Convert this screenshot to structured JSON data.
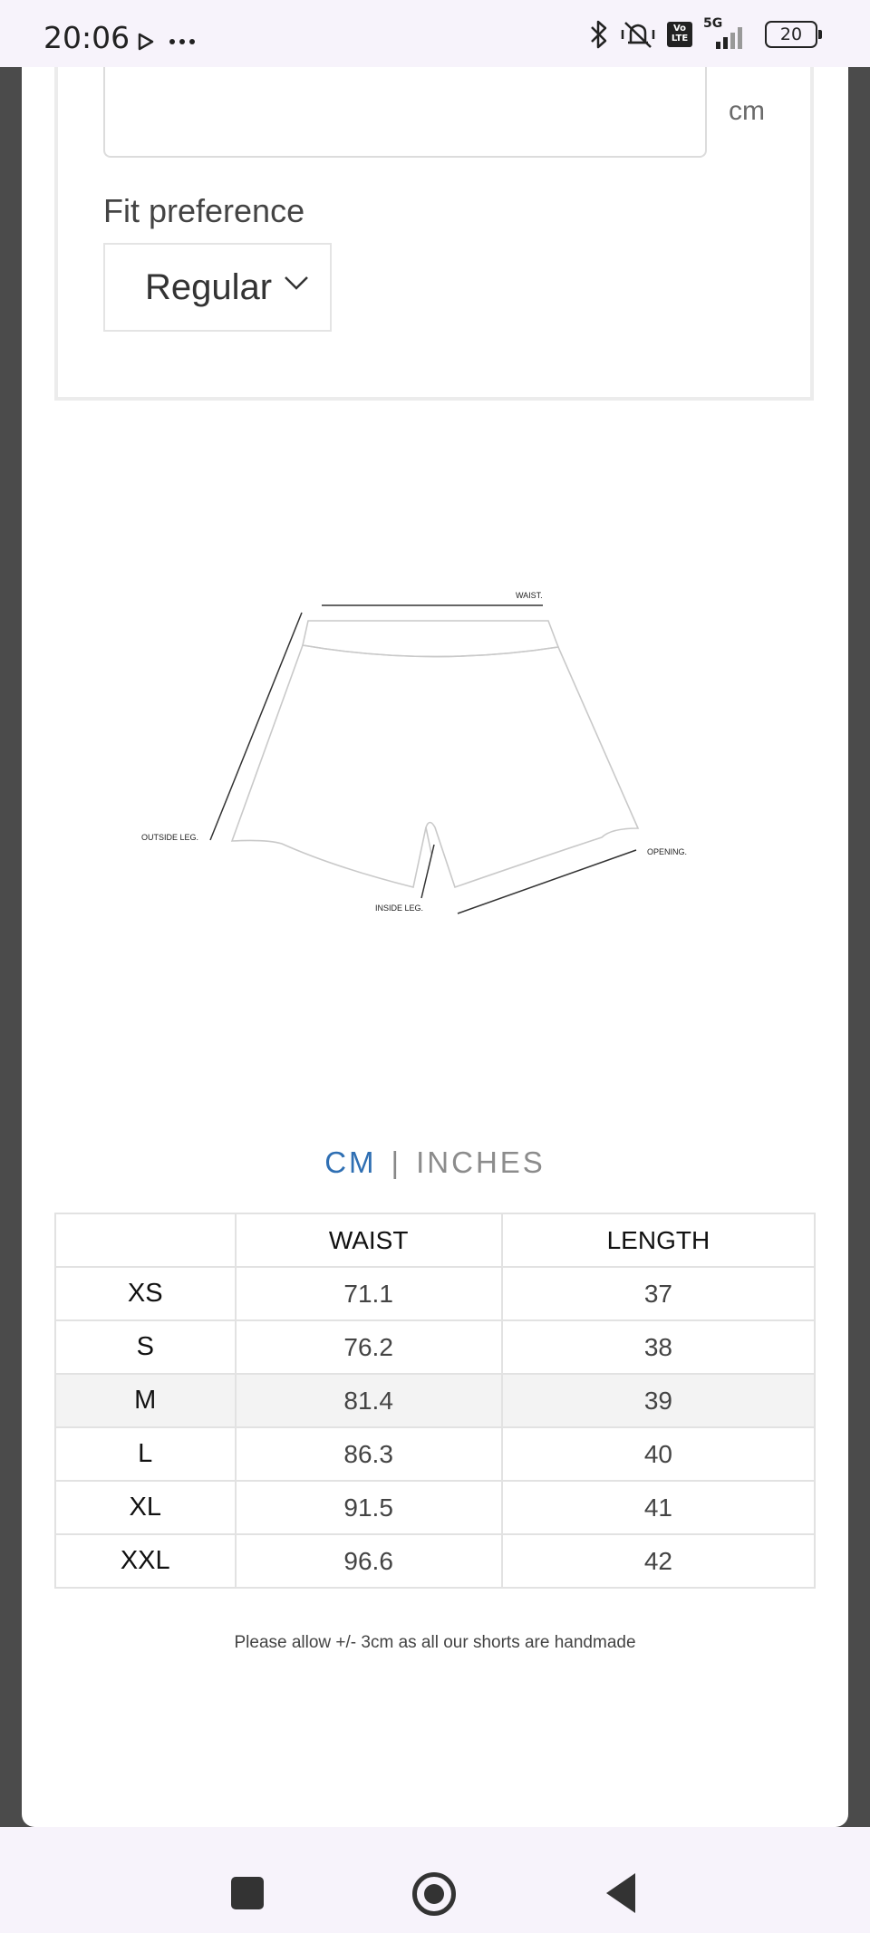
{
  "status_bar": {
    "time": "20:06",
    "network": "5G",
    "lte_badge": "Vo LTE",
    "battery": "20",
    "icons": [
      "play-store-icon",
      "more-dots-icon",
      "bluetooth-icon",
      "muted-vibrate-icon",
      "signal-bars-icon",
      "battery-icon"
    ]
  },
  "fit_form": {
    "measurement_value": "",
    "measurement_unit": "cm",
    "fit_label": "Fit preference",
    "fit_value": "Regular"
  },
  "diagram": {
    "labels": {
      "waist": "WAIST.",
      "outside_leg": "OUTSIDE LEG.",
      "inside_leg": "INSIDE LEG.",
      "opening": "OPENING."
    }
  },
  "unit_toggle": {
    "active": "CM",
    "separator": "|",
    "inactive": "INCHES",
    "active_color": "#2f6fb3"
  },
  "size_table": {
    "headers": [
      "",
      "WAIST",
      "LENGTH"
    ],
    "rows": [
      {
        "size": "XS",
        "waist": "71.1",
        "length": "37"
      },
      {
        "size": "S",
        "waist": "76.2",
        "length": "38"
      },
      {
        "size": "M",
        "waist": "81.4",
        "length": "39"
      },
      {
        "size": "L",
        "waist": "86.3",
        "length": "40"
      },
      {
        "size": "XL",
        "waist": "91.5",
        "length": "41"
      },
      {
        "size": "XXL",
        "waist": "96.6",
        "length": "42"
      }
    ],
    "highlighted_row": "M"
  },
  "footnote": "Please allow +/- 3cm as all our shorts are handmade",
  "nav_bar": {
    "icons": [
      "recents-icon",
      "home-icon",
      "back-icon"
    ]
  }
}
